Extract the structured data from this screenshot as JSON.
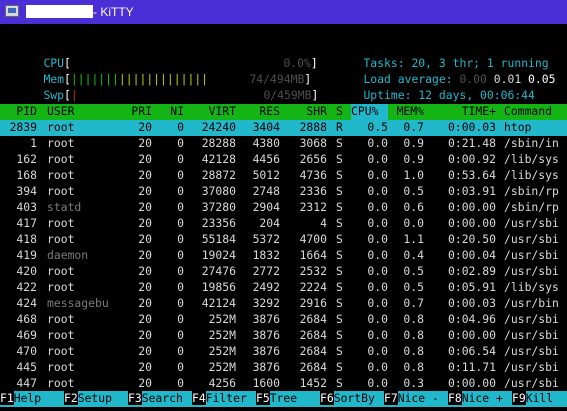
{
  "window": {
    "title": "- KiTTY"
  },
  "meters": {
    "cpu": {
      "label": "CPU",
      "bar": "",
      "value": "0.0%"
    },
    "mem": {
      "label": "Mem",
      "bar": "||||||||||||||||||||",
      "value": "74/494MB"
    },
    "swp": {
      "label": "Swp",
      "bar": "|",
      "value": "0/459MB"
    }
  },
  "summary": {
    "tasks_label": "Tasks:",
    "tasks_value": "20",
    "thr_value": "3",
    "thr_label": "thr;",
    "running_value": "1",
    "running_label": "running",
    "load_label": "Load average:",
    "load1": "0.00",
    "load5": "0.01",
    "load15": "0.05",
    "uptime_label": "Uptime:",
    "uptime_value": "12 days, 00:06:44"
  },
  "columns": [
    "PID",
    "USER",
    "PRI",
    "NI",
    "VIRT",
    "RES",
    "SHR",
    "S",
    "CPU%",
    "MEM%",
    "TIME+",
    "Command"
  ],
  "processes": [
    {
      "pid": "2839",
      "user": "root",
      "pri": "20",
      "ni": "0",
      "virt": "24240",
      "res": "3404",
      "shr": "2888",
      "s": "R",
      "cpu": "0.5",
      "mem": "0.7",
      "time": "0:00.03",
      "cmd": "htop"
    },
    {
      "pid": "1",
      "user": "root",
      "pri": "20",
      "ni": "0",
      "virt": "28288",
      "res": "4380",
      "shr": "3068",
      "s": "S",
      "cpu": "0.0",
      "mem": "0.9",
      "time": "0:21.48",
      "cmd": "/sbin/in"
    },
    {
      "pid": "162",
      "user": "root",
      "pri": "20",
      "ni": "0",
      "virt": "42128",
      "res": "4456",
      "shr": "2656",
      "s": "S",
      "cpu": "0.0",
      "mem": "0.9",
      "time": "0:00.92",
      "cmd": "/lib/sys"
    },
    {
      "pid": "168",
      "user": "root",
      "pri": "20",
      "ni": "0",
      "virt": "28872",
      "res": "5012",
      "shr": "4736",
      "s": "S",
      "cpu": "0.0",
      "mem": "1.0",
      "time": "0:53.64",
      "cmd": "/lib/sys"
    },
    {
      "pid": "394",
      "user": "root",
      "pri": "20",
      "ni": "0",
      "virt": "37080",
      "res": "2748",
      "shr": "2336",
      "s": "S",
      "cpu": "0.0",
      "mem": "0.5",
      "time": "0:03.91",
      "cmd": "/sbin/rp"
    },
    {
      "pid": "403",
      "user": "statd",
      "pri": "20",
      "ni": "0",
      "virt": "37280",
      "res": "2904",
      "shr": "2312",
      "s": "S",
      "cpu": "0.0",
      "mem": "0.6",
      "time": "0:00.00",
      "cmd": "/sbin/rp"
    },
    {
      "pid": "417",
      "user": "root",
      "pri": "20",
      "ni": "0",
      "virt": "23356",
      "res": "204",
      "shr": "4",
      "s": "S",
      "cpu": "0.0",
      "mem": "0.0",
      "time": "0:00.00",
      "cmd": "/usr/sbi"
    },
    {
      "pid": "418",
      "user": "root",
      "pri": "20",
      "ni": "0",
      "virt": "55184",
      "res": "5372",
      "shr": "4700",
      "s": "S",
      "cpu": "0.0",
      "mem": "1.1",
      "time": "0:20.50",
      "cmd": "/usr/sbi"
    },
    {
      "pid": "419",
      "user": "daemon",
      "pri": "20",
      "ni": "0",
      "virt": "19024",
      "res": "1832",
      "shr": "1664",
      "s": "S",
      "cpu": "0.0",
      "mem": "0.4",
      "time": "0:00.04",
      "cmd": "/usr/sbi"
    },
    {
      "pid": "420",
      "user": "root",
      "pri": "20",
      "ni": "0",
      "virt": "27476",
      "res": "2772",
      "shr": "2532",
      "s": "S",
      "cpu": "0.0",
      "mem": "0.5",
      "time": "0:02.89",
      "cmd": "/usr/sbi"
    },
    {
      "pid": "422",
      "user": "root",
      "pri": "20",
      "ni": "0",
      "virt": "19856",
      "res": "2492",
      "shr": "2224",
      "s": "S",
      "cpu": "0.0",
      "mem": "0.5",
      "time": "0:05.91",
      "cmd": "/lib/sys"
    },
    {
      "pid": "424",
      "user": "messagebu",
      "pri": "20",
      "ni": "0",
      "virt": "42124",
      "res": "3292",
      "shr": "2916",
      "s": "S",
      "cpu": "0.0",
      "mem": "0.7",
      "time": "0:00.03",
      "cmd": "/usr/bin"
    },
    {
      "pid": "468",
      "user": "root",
      "pri": "20",
      "ni": "0",
      "virt": "252M",
      "res": "3876",
      "shr": "2684",
      "s": "S",
      "cpu": "0.0",
      "mem": "0.8",
      "time": "0:04.96",
      "cmd": "/usr/sbi"
    },
    {
      "pid": "469",
      "user": "root",
      "pri": "20",
      "ni": "0",
      "virt": "252M",
      "res": "3876",
      "shr": "2684",
      "s": "S",
      "cpu": "0.0",
      "mem": "0.8",
      "time": "0:00.00",
      "cmd": "/usr/sbi"
    },
    {
      "pid": "470",
      "user": "root",
      "pri": "20",
      "ni": "0",
      "virt": "252M",
      "res": "3876",
      "shr": "2684",
      "s": "S",
      "cpu": "0.0",
      "mem": "0.8",
      "time": "0:06.54",
      "cmd": "/usr/sbi"
    },
    {
      "pid": "445",
      "user": "root",
      "pri": "20",
      "ni": "0",
      "virt": "252M",
      "res": "3876",
      "shr": "2684",
      "s": "S",
      "cpu": "0.0",
      "mem": "0.8",
      "time": "0:11.71",
      "cmd": "/usr/sbi"
    },
    {
      "pid": "447",
      "user": "root",
      "pri": "20",
      "ni": "0",
      "virt": "4256",
      "res": "1600",
      "shr": "1452",
      "s": "S",
      "cpu": "0.0",
      "mem": "0.3",
      "time": "0:00.00",
      "cmd": "/usr/sbi"
    }
  ],
  "function_keys": [
    {
      "key": "F1",
      "label": "Help"
    },
    {
      "key": "F2",
      "label": "Setup"
    },
    {
      "key": "F3",
      "label": "Search"
    },
    {
      "key": "F4",
      "label": "Filter"
    },
    {
      "key": "F5",
      "label": "Tree"
    },
    {
      "key": "F6",
      "label": "SortBy"
    },
    {
      "key": "F7",
      "label": "Nice -"
    },
    {
      "key": "F8",
      "label": "Nice +"
    },
    {
      "key": "F9",
      "label": "Kill"
    }
  ]
}
